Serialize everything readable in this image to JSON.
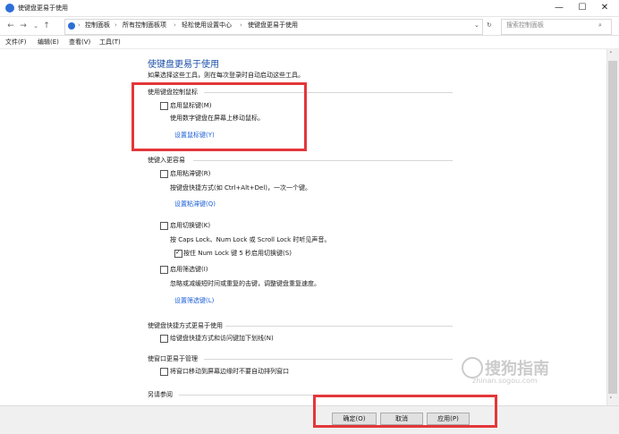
{
  "window": {
    "title": "使键盘更易于使用",
    "controls": {
      "minimize": "—",
      "maximize": "☐",
      "close": "✕"
    }
  },
  "address": {
    "crumbs": [
      "控制面板",
      "所有控制面板项",
      "轻松使用设置中心",
      "使键盘更易于使用"
    ],
    "separator": "›",
    "search_placeholder": "搜索控制面板"
  },
  "menu": [
    "文件(F)",
    "编辑(E)",
    "查看(V)",
    "工具(T)"
  ],
  "page": {
    "title": "使键盘更易于使用",
    "subtitle": "如果选择这些工具，则在每次登录时自动启动这些工具。"
  },
  "sections": {
    "mouse_keys": {
      "header": "使用键盘控制鼠标",
      "checkbox_label": "启用鼠标键(M)",
      "checked": false,
      "desc": "使用数字键盘在屏幕上移动鼠标。",
      "link": "设置鼠标键(Y)"
    },
    "easier_typing": {
      "header": "使键入更容易",
      "sticky": {
        "checkbox_label": "启用粘滞键(R)",
        "checked": false,
        "desc": "按键盘快捷方式(如 Ctrl+Alt+Del)，一次一个键。",
        "link": "设置粘滞键(Q)"
      },
      "toggle": {
        "checkbox_label": "启用切换键(K)",
        "checked": false,
        "desc": "按 Caps Lock、Num Lock 或 Scroll Lock 时听见声音。",
        "sub_checkbox_label": "按住 Num Lock 键 5 秒启用切换键(S)",
        "sub_checked": true
      },
      "filter": {
        "checkbox_label": "启用筛选键(I)",
        "checked": false,
        "desc": "忽略或减缓短时间或重复的击键，调整键盘重复速度。",
        "link": "设置筛选键(L)"
      }
    },
    "shortcuts": {
      "header": "使键盘快捷方式更易于使用",
      "checkbox_label": "给键盘快捷方式和访问键加下划线(N)",
      "checked": false
    },
    "window_mgmt": {
      "header": "使窗口更易于管理",
      "checkbox_label": "将窗口移动到屏幕边缘时不要自动排列窗口",
      "checked": false
    },
    "see_also": {
      "header": "另请参阅"
    }
  },
  "footer": {
    "ok": "确定(O)",
    "cancel": "取消",
    "apply": "应用(P)"
  },
  "watermark": {
    "text": "搜狗指南",
    "url": "zhinan.sogou.com"
  },
  "icons": {
    "back": "←",
    "forward": "→",
    "up": "↑",
    "dropdown": "⌄",
    "refresh": "↻",
    "search": "⌕",
    "scroll_up": "˄",
    "scroll_down": "˅"
  },
  "colors": {
    "highlight_box": "#e3373a",
    "link": "#1b5fd6",
    "title": "#1b4fa8"
  }
}
